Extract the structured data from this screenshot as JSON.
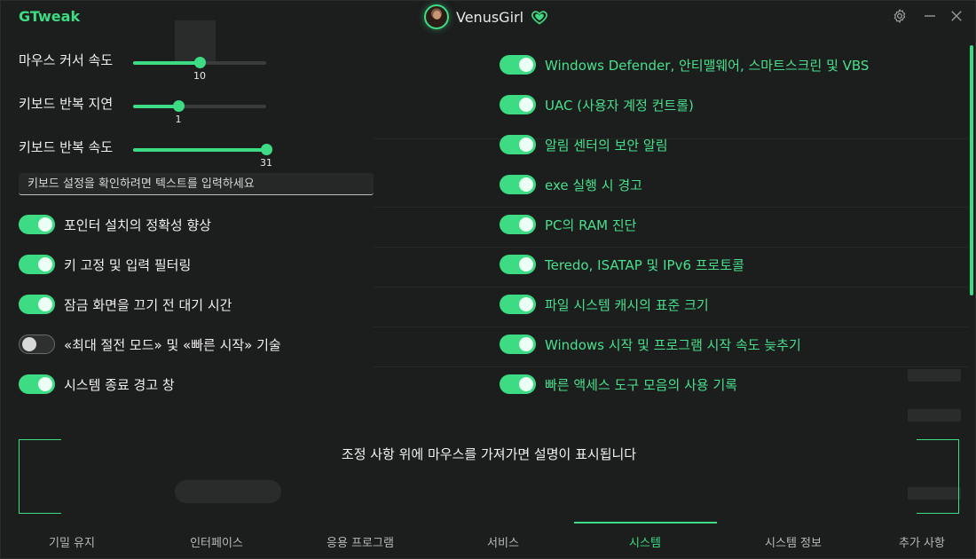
{
  "app": {
    "title": "GTweak"
  },
  "user": {
    "name": "VenusGirl"
  },
  "sliders": [
    {
      "label": "마우스 커서 속도",
      "value": "10",
      "fraction": 0.5
    },
    {
      "label": "키보드 반복 지연",
      "value": "1",
      "fraction": 0.34
    },
    {
      "label": "키보드 반복 속도",
      "value": "31",
      "fraction": 1.0
    }
  ],
  "keyboard_test": {
    "placeholder": "키보드 설정을 확인하려면 텍스트를 입력하세요"
  },
  "left_toggles": [
    {
      "label": "포인터 설치의 정확성 향상",
      "on": true
    },
    {
      "label": "키 고정 및 입력 필터링",
      "on": true
    },
    {
      "label": "잠금 화면을 끄기 전 대기 시간",
      "on": true
    },
    {
      "label": "«최대 절전 모드» 및 «빠른 시작» 기술",
      "on": false
    },
    {
      "label": "시스템 종료 경고 창",
      "on": true
    }
  ],
  "right_toggles": [
    {
      "label": "Windows Defender, 안티맬웨어, 스마트스크린 및 VBS",
      "on": true
    },
    {
      "label": "UAC (사용자 계정 컨트롤)",
      "on": true
    },
    {
      "label": "알림 센터의 보안 알림",
      "on": true
    },
    {
      "label": "exe 실행 시 경고",
      "on": true
    },
    {
      "label": "PC의 RAM 진단",
      "on": true
    },
    {
      "label": "Teredo, ISATAP 및 IPv6 프로토콜",
      "on": true
    },
    {
      "label": "파일 시스템 캐시의 표준 크기",
      "on": true
    },
    {
      "label": "Windows 시작 및 프로그램 시작 속도 늦추기",
      "on": true
    },
    {
      "label": "빠른 액세스 도구 모음의 사용 기록",
      "on": true
    }
  ],
  "hint": {
    "text": "조정 사항 위에 마우스를 가져가면 설명이 표시됩니다"
  },
  "nav": {
    "items": [
      "기밀 유지",
      "인터페이스",
      "응용 프로그램",
      "서비스",
      "시스템",
      "시스템 정보",
      "추가 사항"
    ],
    "active_index": 4
  },
  "colors": {
    "accent": "#3ddc84",
    "background": "#1c1d1d"
  },
  "icons": {
    "settings": "gear-icon",
    "minimize": "minimize-icon",
    "close": "close-icon",
    "badge": "heart-icon"
  }
}
